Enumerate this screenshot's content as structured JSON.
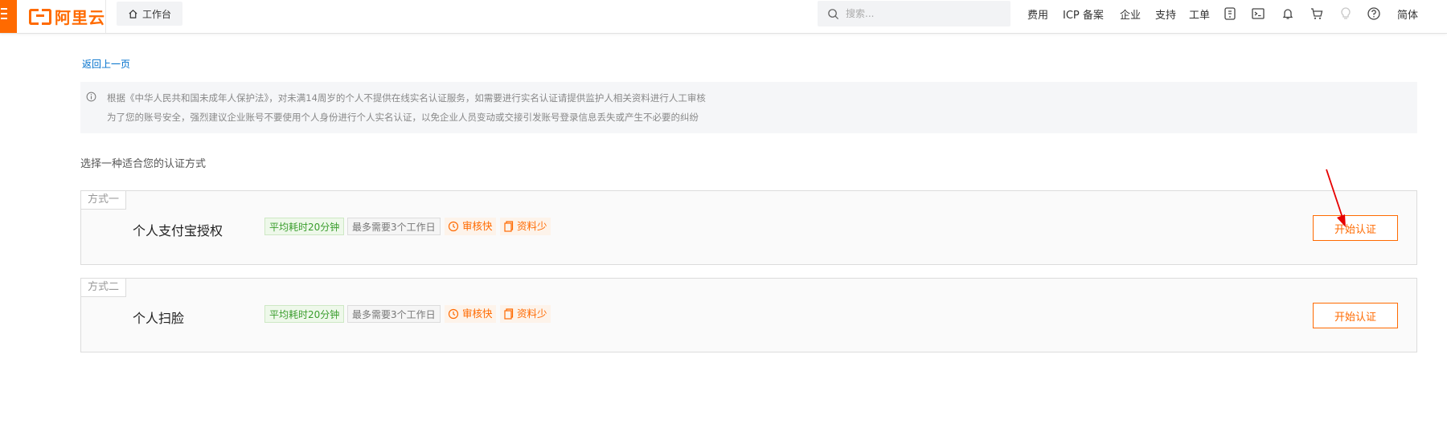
{
  "header": {
    "logo_text": "阿里云",
    "workbench_label": "工作台",
    "search_placeholder": "搜索...",
    "nav": {
      "fees": "费用",
      "icp": "ICP 备案",
      "enterprise": "企业",
      "support": "支持",
      "tickets": "工单",
      "language": "简体"
    },
    "icons": [
      "menu-icon",
      "home-icon",
      "search-icon",
      "app-icon",
      "terminal-icon",
      "bell-icon",
      "cart-icon",
      "lightbulb-icon",
      "help-icon"
    ]
  },
  "page": {
    "back_link": "返回上一页",
    "notice": {
      "line1": "根据《中华人民共和国未成年人保护法》，对未满14周岁的个人不提供在线实名认证服务，如需要进行实名认证请提供监护人相关资料进行人工审核",
      "line2": "为了您的账号安全，强烈建议企业账号不要使用个人身份进行个人实名认证，以免企业人员变动或交接引发账号登录信息丢失或产生不必要的纠纷"
    },
    "section_title": "选择一种适合您的认证方式",
    "methods": [
      {
        "tag": "方式一",
        "name": "个人支付宝授权",
        "badge_time": "平均耗时20分钟",
        "badge_days": "最多需要3个工作日",
        "badge_fast": "审核快",
        "badge_less": "资料少",
        "button": "开始认证"
      },
      {
        "tag": "方式二",
        "name": "个人扫脸",
        "badge_time": "平均耗时20分钟",
        "badge_days": "最多需要3个工作日",
        "badge_fast": "审核快",
        "badge_less": "资料少",
        "button": "开始认证"
      }
    ]
  },
  "colors": {
    "brand": "#ff6a00",
    "link": "#0070cc",
    "success": "#3a9d2d",
    "annotation_arrow": "#e60000"
  }
}
